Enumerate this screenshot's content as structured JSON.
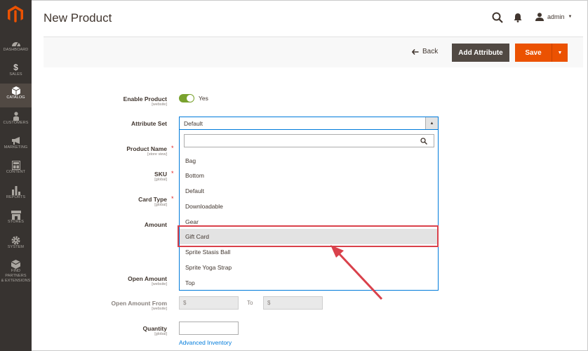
{
  "nav": [
    {
      "label": "DASHBOARD",
      "icon": "dashboard-icon"
    },
    {
      "label": "SALES",
      "icon": "dollar-icon"
    },
    {
      "label": "CATALOG",
      "icon": "cube-icon",
      "active": true
    },
    {
      "label": "CUSTOMERS",
      "icon": "person-icon"
    },
    {
      "label": "MARKETING",
      "icon": "megaphone-icon"
    },
    {
      "label": "CONTENT",
      "icon": "layout-icon"
    },
    {
      "label": "REPORTS",
      "icon": "bar-chart-icon"
    },
    {
      "label": "STORES",
      "icon": "storefront-icon"
    },
    {
      "label": "SYSTEM",
      "icon": "gear-icon"
    },
    {
      "label": "FIND PARTNERS",
      "label2": "& EXTENSIONS",
      "icon": "boxes-icon"
    }
  ],
  "header": {
    "title": "New Product",
    "user": "admin"
  },
  "toolbar": {
    "back_label": "Back",
    "add_attribute_label": "Add Attribute",
    "save_label": "Save"
  },
  "form": {
    "enable_product": {
      "label": "Enable Product",
      "scope": "[website]",
      "value": "Yes"
    },
    "attribute_set": {
      "label": "Attribute Set",
      "value": "Default"
    },
    "product_name": {
      "label": "Product Name",
      "scope": "[store view]"
    },
    "sku": {
      "label": "SKU",
      "scope": "[global]"
    },
    "card_type": {
      "label": "Card Type",
      "scope": "[global]"
    },
    "amount": {
      "label": "Amount"
    },
    "open_amount": {
      "label": "Open Amount",
      "scope": "[website]"
    },
    "open_amount_from": {
      "label": "Open Amount From",
      "scope": "[website]",
      "from_placeholder": "$",
      "to_label": "To",
      "to_placeholder": "$"
    },
    "quantity": {
      "label": "Quantity",
      "scope": "[global]"
    },
    "advanced_inventory_link": "Advanced Inventory"
  },
  "dropdown": {
    "options": [
      "Bag",
      "Bottom",
      "Default",
      "Downloadable",
      "Gear",
      "Gift Card",
      "Sprite Stasis Ball",
      "Sprite Yoga Strap",
      "Top"
    ],
    "highlighted": "Gift Card"
  },
  "colors": {
    "sidebar": "#373330",
    "accent": "#eb5202",
    "annotation": "#d9414b"
  }
}
